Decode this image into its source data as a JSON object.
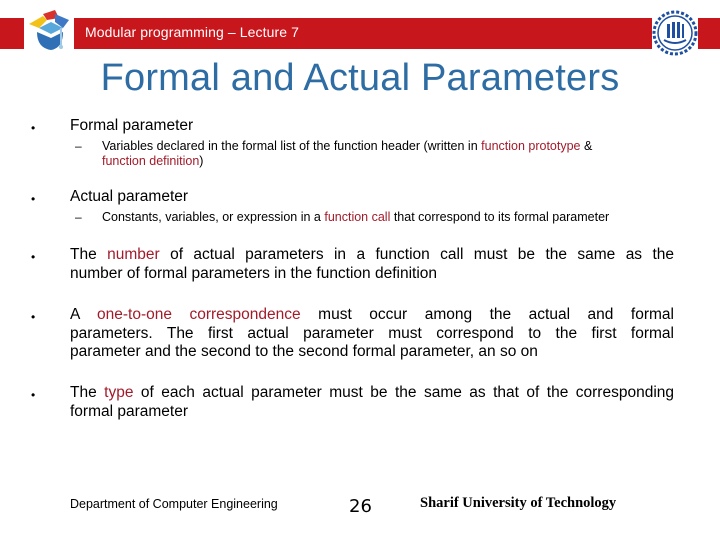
{
  "header": {
    "course_title": "Modular programming – Lecture 7",
    "left_logo_icon": "graduation-cap-puzzle-logo",
    "right_logo_icon": "sharif-university-emblem",
    "band_color": "#c8161d"
  },
  "slide": {
    "title": "Formal and Actual Parameters",
    "title_color": "#2e6ca4",
    "highlight_color": "#a11c2a",
    "bullets": [
      {
        "heading": "Formal parameter",
        "sub": {
          "part1": "Variables declared in the formal list of the function header (written in ",
          "hl1": "function prototype",
          "part2": " &",
          "hl2": "function definition",
          "part3": ")"
        }
      },
      {
        "heading": "Actual parameter",
        "sub": {
          "part1": "Constants, variables, or expression in a ",
          "hl1": "function call",
          "part2": " that correspond to its formal parameter"
        }
      },
      {
        "line1_a": "The ",
        "line1_hl": "number",
        "line1_b": " of actual parameters in a function call must be the same as the",
        "line2": "number of formal parameters in the function definition"
      },
      {
        "line1_a": "A ",
        "line1_hl": "one-to-one correspondence",
        "line1_b": " must occur among the actual and formal",
        "line2": "parameters.  The first actual parameter must correspond to the first formal",
        "line3": "parameter and the second to the second formal parameter, an so on"
      },
      {
        "line1_a": "The ",
        "line1_hl": "type",
        "line1_b": " of each actual parameter must be the same as that of the corresponding",
        "line2": "formal parameter"
      }
    ],
    "bullet_glyph": "•",
    "dash_glyph": "–"
  },
  "footer": {
    "department": "Department of Computer Engineering",
    "page_number": "26",
    "university": "Sharif University of Technology"
  }
}
